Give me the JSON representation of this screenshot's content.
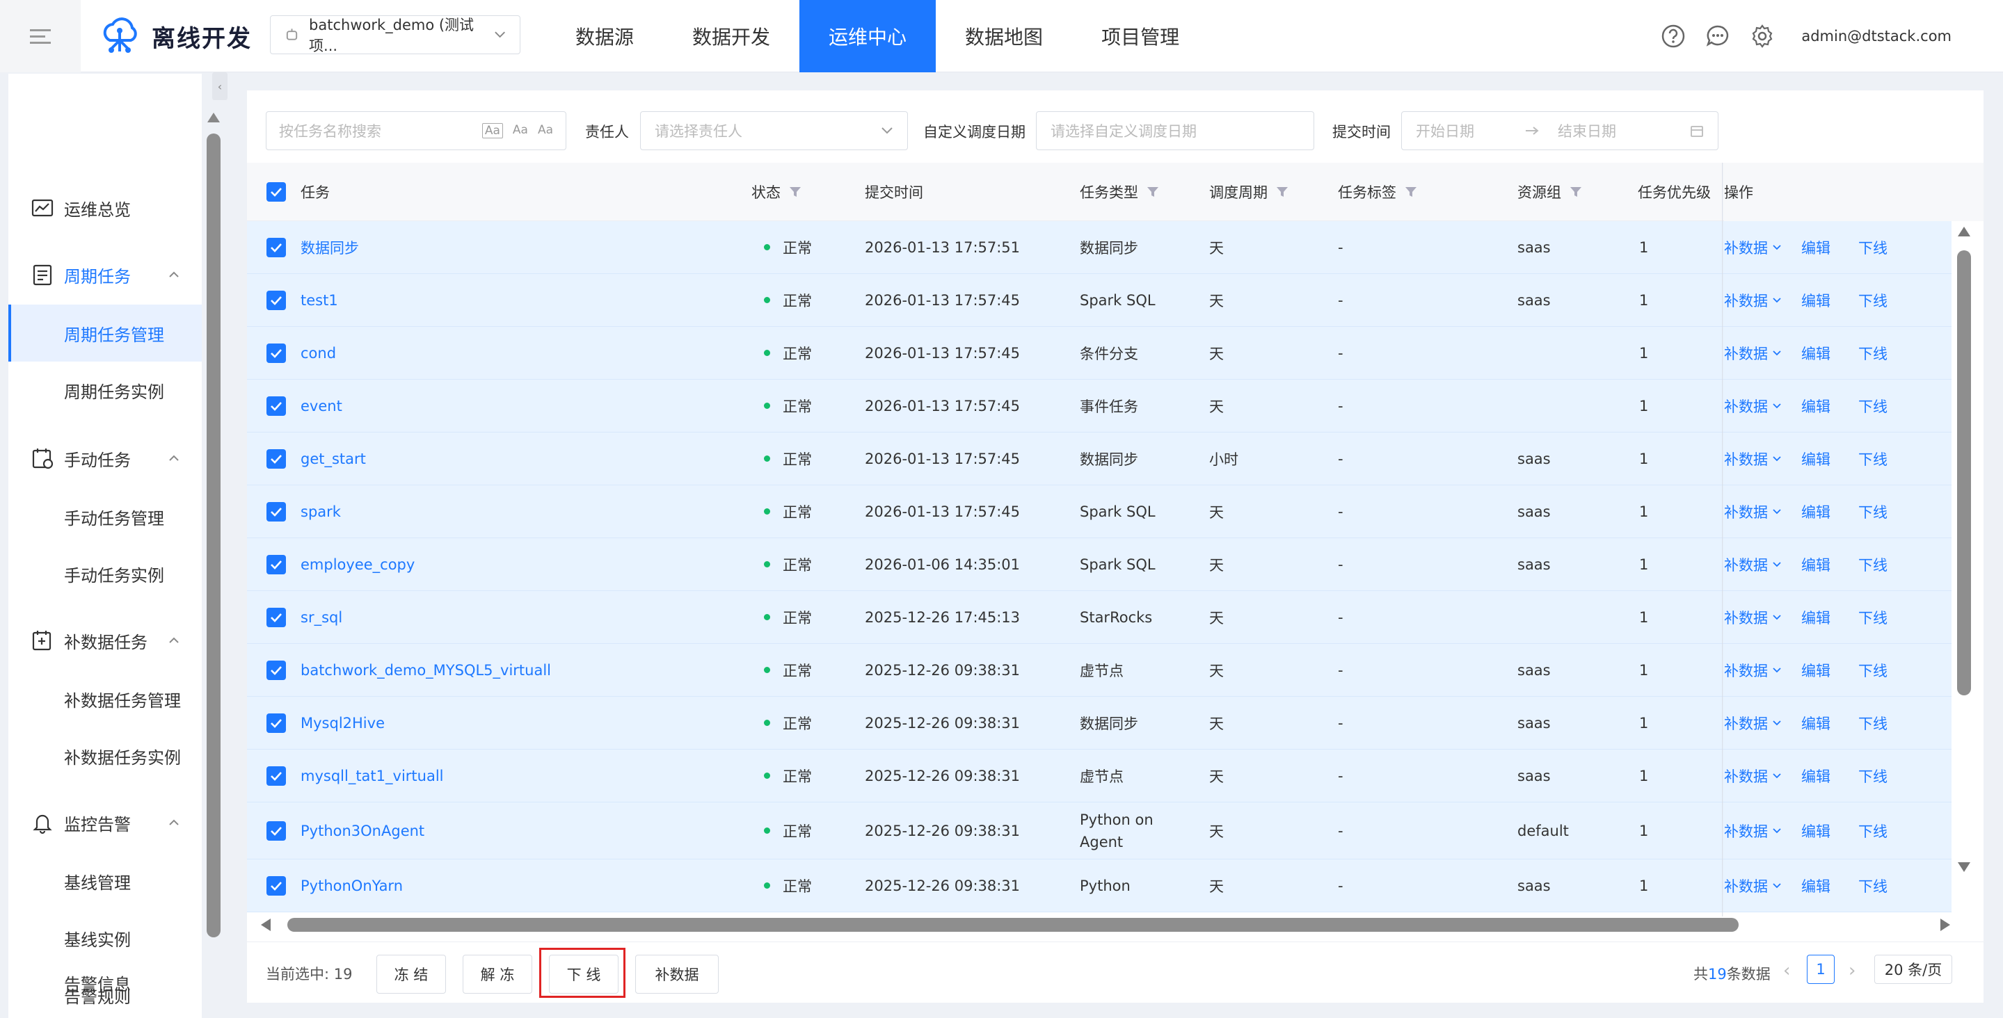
{
  "header": {
    "app_name": "离线开发",
    "project": "batchwork_demo (测试项...",
    "nav": [
      "数据源",
      "数据开发",
      "运维中心",
      "数据地图",
      "项目管理"
    ],
    "active_nav": "运维中心",
    "user": "admin@dtstack.com"
  },
  "sidebar": {
    "groups": [
      {
        "label": "运维总览",
        "icon": "dashboard-icon"
      },
      {
        "label": "周期任务",
        "icon": "calendar-task-icon",
        "items": [
          "周期任务管理",
          "周期任务实例"
        ]
      },
      {
        "label": "手动任务",
        "icon": "manual-task-icon",
        "items": [
          "手动任务管理",
          "手动任务实例"
        ]
      },
      {
        "label": "补数据任务",
        "icon": "patch-data-icon",
        "items": [
          "补数据任务管理",
          "补数据任务实例"
        ]
      },
      {
        "label": "监控告警",
        "icon": "bell-icon",
        "items": [
          "基线管理",
          "基线实例",
          "告警规则",
          "告警信息"
        ]
      }
    ],
    "active_item": "周期任务管理"
  },
  "filters": {
    "search_placeholder": "按任务名称搜索",
    "search_tools": [
      "Aa",
      "Aa",
      "Aa"
    ],
    "owner_label": "责任人",
    "owner_placeholder": "请选择责任人",
    "custom_date_label": "自定义调度日期",
    "custom_date_placeholder": "请选择自定义调度日期",
    "submit_time_label": "提交时间",
    "start_placeholder": "开始日期",
    "end_placeholder": "结束日期"
  },
  "table": {
    "columns": [
      "任务",
      "状态",
      "提交时间",
      "任务类型",
      "调度周期",
      "任务标签",
      "资源组",
      "任务优先级",
      "操作"
    ],
    "rows": [
      {
        "name": "数据同步",
        "status": "正常",
        "time": "2026-01-13 17:57:51",
        "type": "数据同步",
        "cycle": "天",
        "tag": "-",
        "group": "saas",
        "priority": "1"
      },
      {
        "name": "test1",
        "status": "正常",
        "time": "2026-01-13 17:57:45",
        "type": "Spark SQL",
        "cycle": "天",
        "tag": "-",
        "group": "saas",
        "priority": "1"
      },
      {
        "name": "cond",
        "status": "正常",
        "time": "2026-01-13 17:57:45",
        "type": "条件分支",
        "cycle": "天",
        "tag": "-",
        "group": "",
        "priority": "1"
      },
      {
        "name": "event",
        "status": "正常",
        "time": "2026-01-13 17:57:45",
        "type": "事件任务",
        "cycle": "天",
        "tag": "-",
        "group": "",
        "priority": "1"
      },
      {
        "name": "get_start",
        "status": "正常",
        "time": "2026-01-13 17:57:45",
        "type": "数据同步",
        "cycle": "小时",
        "tag": "-",
        "group": "saas",
        "priority": "1"
      },
      {
        "name": "spark",
        "status": "正常",
        "time": "2026-01-13 17:57:45",
        "type": "Spark SQL",
        "cycle": "天",
        "tag": "-",
        "group": "saas",
        "priority": "1"
      },
      {
        "name": "employee_copy",
        "status": "正常",
        "time": "2026-01-06 14:35:01",
        "type": "Spark SQL",
        "cycle": "天",
        "tag": "-",
        "group": "saas",
        "priority": "1"
      },
      {
        "name": "sr_sql",
        "status": "正常",
        "time": "2025-12-26 17:45:13",
        "type": "StarRocks",
        "cycle": "天",
        "tag": "-",
        "group": "",
        "priority": "1"
      },
      {
        "name": "batchwork_demo_MYSQL5_virtuall",
        "status": "正常",
        "time": "2025-12-26 09:38:31",
        "type": "虚节点",
        "cycle": "天",
        "tag": "-",
        "group": "saas",
        "priority": "1"
      },
      {
        "name": "Mysql2Hive",
        "status": "正常",
        "time": "2025-12-26 09:38:31",
        "type": "数据同步",
        "cycle": "天",
        "tag": "-",
        "group": "saas",
        "priority": "1"
      },
      {
        "name": "mysqll_tat1_virtuall",
        "status": "正常",
        "time": "2025-12-26 09:38:31",
        "type": "虚节点",
        "cycle": "天",
        "tag": "-",
        "group": "saas",
        "priority": "1"
      },
      {
        "name": "Python3OnAgent",
        "status": "正常",
        "time": "2025-12-26 09:38:31",
        "type": "Python on",
        "type2": "Agent",
        "cycle": "天",
        "tag": "-",
        "group": "default",
        "priority": "1"
      },
      {
        "name": "PythonOnYarn",
        "status": "正常",
        "time": "2025-12-26 09:38:31",
        "type": "Python",
        "cycle": "天",
        "tag": "-",
        "group": "saas",
        "priority": "1"
      }
    ],
    "ops": {
      "patch": "补数据",
      "edit": "编辑",
      "offline": "下线"
    }
  },
  "footer": {
    "selected_prefix": "当前选中:",
    "selected_count": "19",
    "buttons": [
      "冻 结",
      "解 冻",
      "下 线",
      "补数据"
    ],
    "total_prefix": "共",
    "total_count": "19",
    "total_suffix": "条数据",
    "current_page": "1",
    "page_size": "20 条/页"
  },
  "colors": {
    "primary": "#1D78FF",
    "row_selected": "#e8f3ff",
    "status_ok": "#12bc6a",
    "highlight": "#e02424"
  }
}
